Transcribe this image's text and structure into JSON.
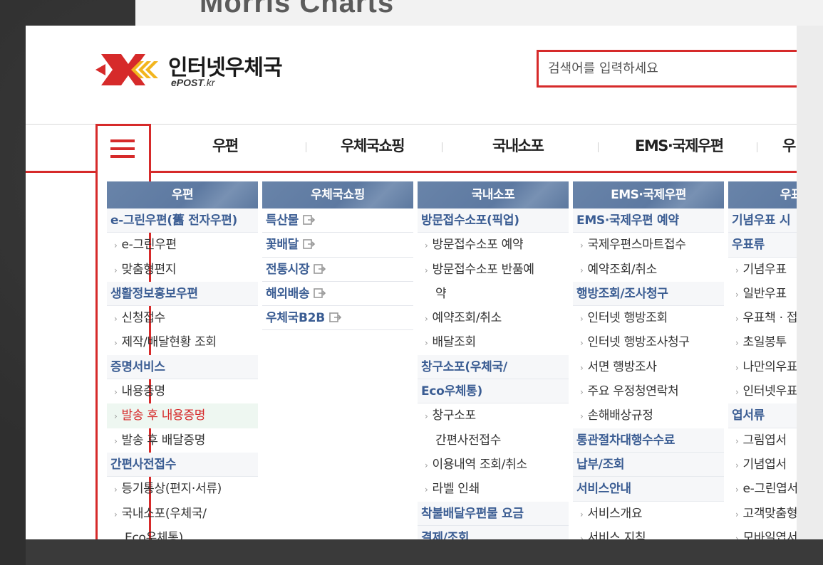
{
  "backdrop": {
    "caption": "Morris Charts"
  },
  "brand": {
    "title": "인터넷우체국",
    "sub_prefix": "ePOST",
    "sub_suffix": ".kr",
    "colors": {
      "red": "#d62a2a",
      "yellow": "#f2b51e"
    }
  },
  "search": {
    "placeholder": "검색어를 입력하세요"
  },
  "nav": {
    "menu_icon": "hamburger-icon",
    "items": [
      "우편",
      "우체국쇼핑",
      "국내소포",
      "EMS·국제우편",
      "우"
    ]
  },
  "columns": [
    {
      "title": "우편",
      "rows": [
        {
          "type": "cat",
          "label": "e-그린우편(舊 전자우편)"
        },
        {
          "type": "sub",
          "label": "e-그린우편"
        },
        {
          "type": "sub",
          "label": "맞춤형편지"
        },
        {
          "type": "cat",
          "label": "생활정보홍보우편"
        },
        {
          "type": "sub",
          "label": "신청접수"
        },
        {
          "type": "sub",
          "label": "제작/배달현황 조회"
        },
        {
          "type": "cat",
          "label": "증명서비스"
        },
        {
          "type": "sub",
          "label": "내용증명"
        },
        {
          "type": "sub",
          "label": "발송 후 내용증명",
          "highlight": true
        },
        {
          "type": "sub",
          "label": "발송 후 배달증명"
        },
        {
          "type": "cat",
          "label": "간편사전접수"
        },
        {
          "type": "sub",
          "label": "등기통상(편지·서류)"
        },
        {
          "type": "sub",
          "label": "국내소포(우체국/"
        },
        {
          "type": "plain",
          "label": "Eco우체통)"
        }
      ]
    },
    {
      "title": "우체국쇼핑",
      "rows": [
        {
          "type": "cat",
          "label": "특산물",
          "external": true
        },
        {
          "type": "cat",
          "label": "꽃배달",
          "external": true
        },
        {
          "type": "cat",
          "label": "전통시장",
          "external": true
        },
        {
          "type": "cat",
          "label": "해외배송",
          "external": true
        },
        {
          "type": "cat",
          "label": "우체국B2B",
          "external": true
        }
      ]
    },
    {
      "title": "국내소포",
      "rows": [
        {
          "type": "cat",
          "label": "방문접수소포(픽업)"
        },
        {
          "type": "sub",
          "label": "방문접수소포 예약"
        },
        {
          "type": "sub",
          "label": "방문접수소포 반품예"
        },
        {
          "type": "plain",
          "label": "약"
        },
        {
          "type": "sub",
          "label": "예약조회/취소"
        },
        {
          "type": "sub",
          "label": "배달조회"
        },
        {
          "type": "cat",
          "label": "창구소포(우체국/"
        },
        {
          "type": "cat",
          "label": "Eco우체통)"
        },
        {
          "type": "sub",
          "label": "창구소포"
        },
        {
          "type": "plain",
          "label": "간편사전접수"
        },
        {
          "type": "sub",
          "label": "이용내역 조회/취소"
        },
        {
          "type": "sub",
          "label": "라벨 인쇄"
        },
        {
          "type": "cat",
          "label": "착불배달우편물 요금"
        },
        {
          "type": "cat",
          "label": "결제/조회"
        }
      ]
    },
    {
      "title": "EMS·국제우편",
      "rows": [
        {
          "type": "cat",
          "label": "EMS·국제우편 예약"
        },
        {
          "type": "sub",
          "label": "국제우편스마트접수"
        },
        {
          "type": "sub",
          "label": "예약조회/취소"
        },
        {
          "type": "cat",
          "label": "행방조회/조사청구"
        },
        {
          "type": "sub",
          "label": "인터넷 행방조회"
        },
        {
          "type": "sub",
          "label": "인터넷 행방조사청구"
        },
        {
          "type": "sub",
          "label": "서면 행방조사"
        },
        {
          "type": "sub",
          "label": "주요 우정청연락처"
        },
        {
          "type": "sub",
          "label": "손해배상규정"
        },
        {
          "type": "cat",
          "label": "통관절차대행수수료"
        },
        {
          "type": "cat",
          "label": "납부/조회"
        },
        {
          "type": "cat",
          "label": "서비스안내"
        },
        {
          "type": "sub",
          "label": "서비스개요"
        },
        {
          "type": "sub",
          "label": "서비스 지침"
        }
      ]
    },
    {
      "title": "우표·엽서",
      "rows": [
        {
          "type": "cat",
          "label": "기념우표 시"
        },
        {
          "type": "cat",
          "label": "우표류"
        },
        {
          "type": "sub",
          "label": "기념우표"
        },
        {
          "type": "sub",
          "label": "일반우표"
        },
        {
          "type": "sub",
          "label": "우표책 · 접"
        },
        {
          "type": "sub",
          "label": "초일봉투"
        },
        {
          "type": "sub",
          "label": "나만의우표"
        },
        {
          "type": "sub",
          "label": "인터넷우표"
        },
        {
          "type": "cat",
          "label": "엽서류"
        },
        {
          "type": "sub",
          "label": "그림엽서"
        },
        {
          "type": "sub",
          "label": "기념엽서"
        },
        {
          "type": "sub",
          "label": "e-그린엽서"
        },
        {
          "type": "sub",
          "label": "고객맞춤형"
        },
        {
          "type": "sub",
          "label": "모바일엽서"
        }
      ]
    }
  ]
}
